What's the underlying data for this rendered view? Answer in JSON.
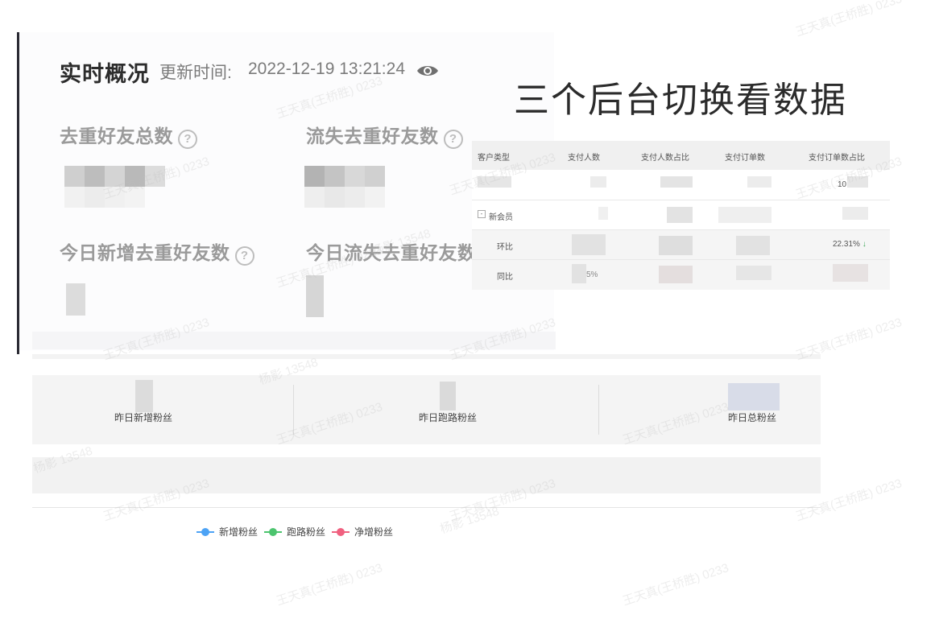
{
  "realtime": {
    "title": "实时概况",
    "update_label": "更新时间:",
    "update_time": "2022-12-19 13:21:24",
    "visibility_icon": "eye-icon"
  },
  "metrics": {
    "dedup_total_friends": "去重好友总数",
    "lost_dedup_friends": "流失去重好友数",
    "today_new_dedup_friends": "今日新增去重好友数",
    "today_lost_dedup_friends": "今日流失去重好友数",
    "help_icon": "question-circle-icon"
  },
  "overlay_caption": "三个后台切换看数据",
  "table": {
    "headers": [
      "客户类型",
      "支付人数",
      "支付人数占比",
      "支付订单数",
      "支付订单数占比"
    ],
    "rows": [
      {
        "type": "",
        "ratio": "10"
      },
      {
        "type": "新会员",
        "expander": "-"
      },
      {
        "type": "环比",
        "ratio": "22.31%",
        "trend_icon": "down-arrow-icon"
      },
      {
        "type": "同比",
        "value": "5%"
      }
    ]
  },
  "fans": {
    "yesterday_new": "昨日新增粉丝",
    "yesterday_lost": "昨日跑路粉丝",
    "yesterday_total": "昨日总粉丝"
  },
  "legend": [
    {
      "label": "新增粉丝",
      "color": "#4da3f5"
    },
    {
      "label": "跑路粉丝",
      "color": "#4cc46e"
    },
    {
      "label": "净增粉丝",
      "color": "#f0607f"
    }
  ],
  "watermark": {
    "name": "王天真(王桥胜) 0233",
    "id": "杨影 13548"
  }
}
